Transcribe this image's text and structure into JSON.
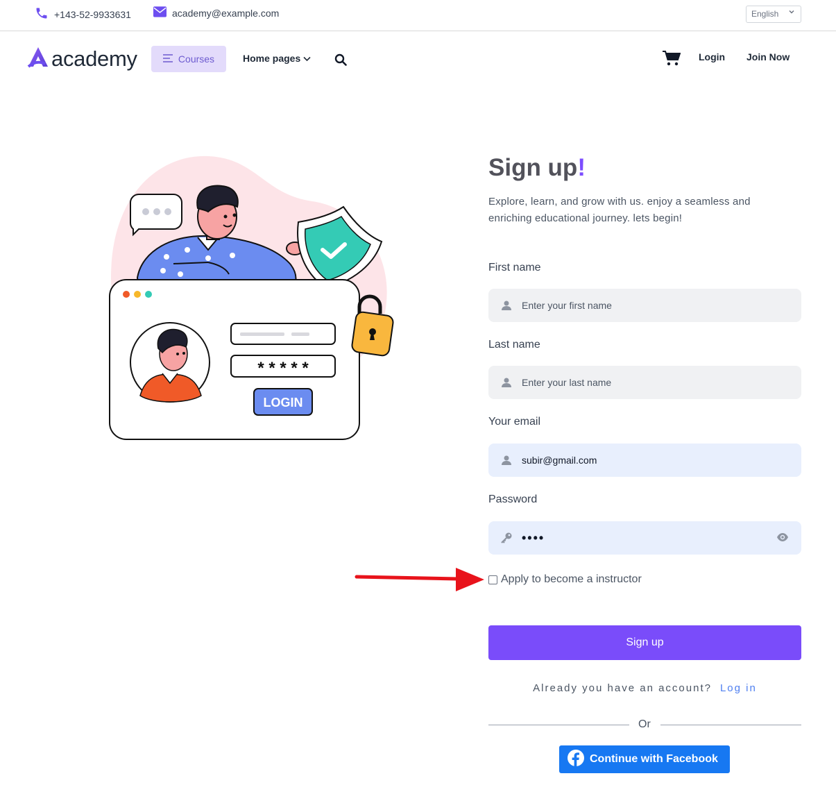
{
  "topbar": {
    "phone": "+143-52-9933631",
    "email": "academy@example.com",
    "language": "English"
  },
  "nav": {
    "logo_text": "academy",
    "courses": "Courses",
    "home_pages": "Home pages",
    "login": "Login",
    "join_now": "Join Now"
  },
  "illustration": {
    "login_button_text": "LOGIN",
    "password_mask": "* * * * *"
  },
  "form": {
    "title": "Sign up",
    "title_mark": "!",
    "subtitle": "Explore, learn, and grow with us. enjoy a seamless and enriching educational journey. lets begin!",
    "first_name_label": "First name",
    "first_name_placeholder": "Enter your first name",
    "last_name_label": "Last name",
    "last_name_placeholder": "Enter your last name",
    "email_label": "Your email",
    "email_value": "subir@gmail.com",
    "password_label": "Password",
    "password_value": "••••",
    "instructor_checkbox": "Apply to become a instructor",
    "signup_button": "Sign up",
    "already_text": "Already you have an account?",
    "login_link": "Log in",
    "or_text": "Or",
    "facebook_button": "Continue with Facebook"
  },
  "colors": {
    "brand": "#7a4cfa",
    "facebook": "#1778f2",
    "annotation_arrow": "#e8131b"
  }
}
